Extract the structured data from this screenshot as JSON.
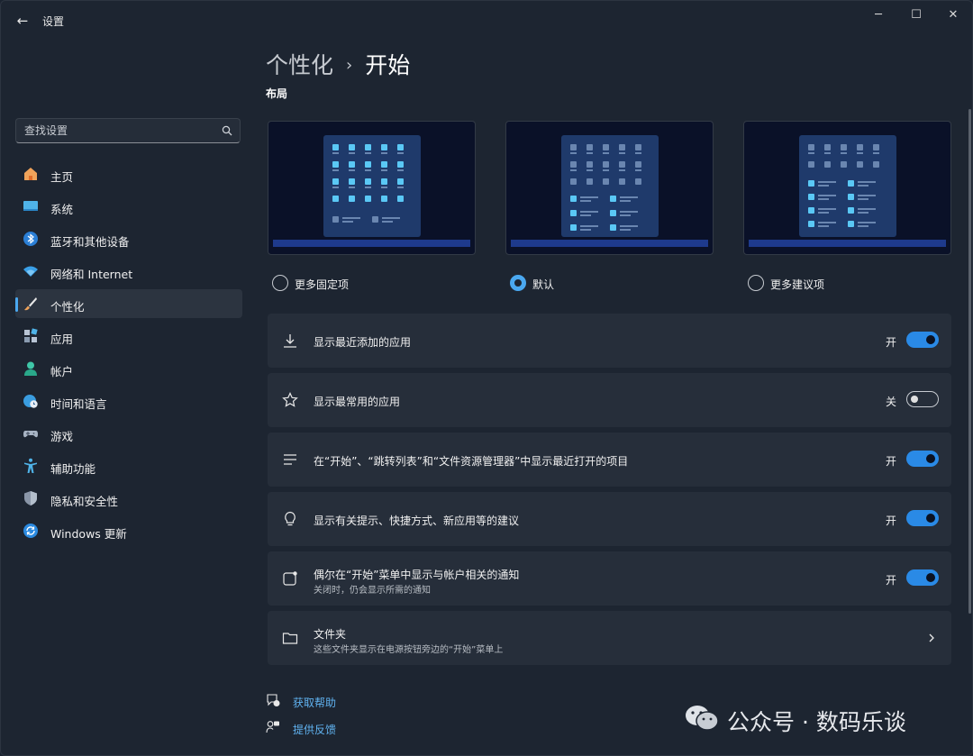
{
  "window": {
    "title": "设置",
    "back": "←",
    "minimize": "─",
    "maximize": "☐",
    "close": "✕"
  },
  "search": {
    "placeholder": "查找设置"
  },
  "sidebar": {
    "items": [
      {
        "label": "主页",
        "icon": "home-icon"
      },
      {
        "label": "系统",
        "icon": "display-icon"
      },
      {
        "label": "蓝牙和其他设备",
        "icon": "bluetooth-icon"
      },
      {
        "label": "网络和 Internet",
        "icon": "wifi-icon"
      },
      {
        "label": "个性化",
        "icon": "brush-icon",
        "active": true
      },
      {
        "label": "应用",
        "icon": "apps-icon"
      },
      {
        "label": "帐户",
        "icon": "account-icon"
      },
      {
        "label": "时间和语言",
        "icon": "globe-clock-icon"
      },
      {
        "label": "游戏",
        "icon": "gamepad-icon"
      },
      {
        "label": "辅助功能",
        "icon": "accessibility-icon"
      },
      {
        "label": "隐私和安全性",
        "icon": "shield-icon"
      },
      {
        "label": "Windows 更新",
        "icon": "update-icon"
      }
    ]
  },
  "breadcrumb": {
    "parent": "个性化",
    "separator": "›",
    "current": "开始"
  },
  "layout": {
    "title": "布局",
    "options": [
      {
        "label": "更多固定项",
        "selected": false
      },
      {
        "label": "默认",
        "selected": true
      },
      {
        "label": "更多建议项",
        "selected": false
      }
    ]
  },
  "settings": [
    {
      "title": "显示最近添加的应用",
      "state": "开",
      "on": true,
      "icon": "download-icon"
    },
    {
      "title": "显示最常用的应用",
      "state": "关",
      "on": false,
      "icon": "star-icon"
    },
    {
      "title": "在“开始”、“跳转列表”和“文件资源管理器”中显示最近打开的项目",
      "state": "开",
      "on": true,
      "icon": "list-icon"
    },
    {
      "title": "显示有关提示、快捷方式、新应用等的建议",
      "state": "开",
      "on": true,
      "icon": "lightbulb-icon"
    },
    {
      "title": "偶尔在“开始”菜单中显示与帐户相关的通知",
      "subtitle": "关闭时，仍会显示所需的通知",
      "state": "开",
      "on": true,
      "icon": "notification-icon"
    },
    {
      "title": "文件夹",
      "subtitle": "这些文件夹显示在电源按钮旁边的“开始”菜单上",
      "icon": "folder-icon"
    }
  ],
  "links": {
    "help": "获取帮助",
    "feedback": "提供反馈"
  },
  "watermark": {
    "text": "公众号 · 数码乐谈"
  },
  "colors": {
    "accent": "#2a8ae6",
    "link": "#60b2f0",
    "background": "#1d2531",
    "card": "#262e3a"
  }
}
